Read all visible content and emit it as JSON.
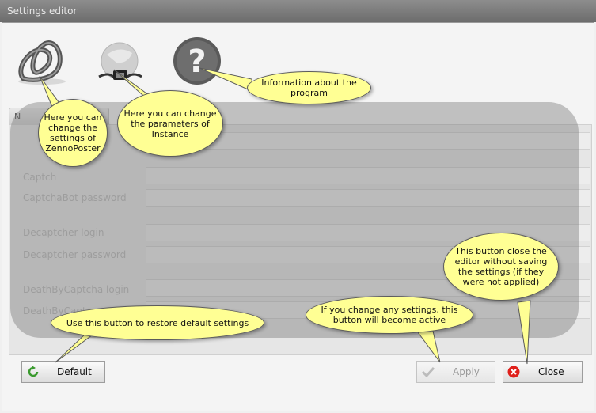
{
  "window": {
    "title": "Settings editor"
  },
  "tab": {
    "label": "N"
  },
  "fields": [
    {
      "label": "Captch"
    },
    {
      "label": "CaptchaBot password"
    },
    {
      "label": "Decaptcher login"
    },
    {
      "label": "Decaptcher password"
    },
    {
      "label": "DeathByCaptcha login"
    },
    {
      "label": "DeathByCapt"
    }
  ],
  "buttons": {
    "default": "Default",
    "apply": "Apply",
    "close": "Close"
  },
  "callouts": {
    "zenno": "Here you can change the settings of ZennoPoster",
    "instance": "Here you can change the parameters of Instance",
    "info": "Information about the program",
    "default": "Use this button to restore default settings",
    "apply": "If you change any settings, this button will become active",
    "close": "This button close the editor without saving the settings (if they were not applied)"
  },
  "colors": {
    "callout": "#ffff94",
    "close_icon": "#e0201b",
    "default_icon": "#3a9a2e"
  }
}
